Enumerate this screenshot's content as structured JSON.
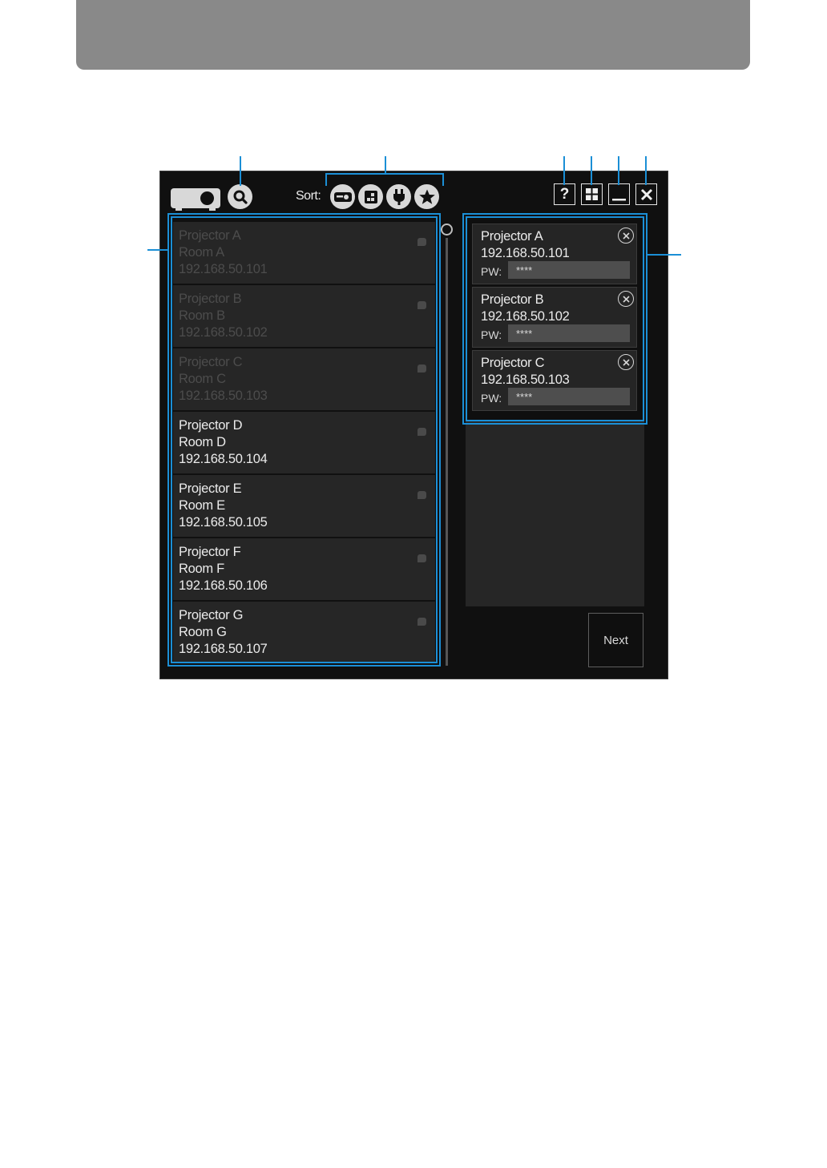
{
  "window": {
    "sort_label": "Sort:",
    "next_label": "Next",
    "icons": {
      "logo": "projector-logo-icon",
      "search": "search-icon",
      "sort_buttons": [
        "sort-by-projector-name-icon",
        "sort-by-room-icon",
        "sort-by-connection-icon",
        "sort-by-favorite-icon"
      ],
      "title_bar": [
        "help-icon",
        "grid-view-icon",
        "minimize-icon",
        "close-icon"
      ]
    }
  },
  "projector_list": [
    {
      "name": "Projector A",
      "room": "Room A",
      "ip": "192.168.50.101",
      "state": "dim"
    },
    {
      "name": "Projector B",
      "room": "Room B",
      "ip": "192.168.50.102",
      "state": "dim"
    },
    {
      "name": "Projector C",
      "room": "Room C",
      "ip": "192.168.50.103",
      "state": "dim"
    },
    {
      "name": "Projector D",
      "room": "Room D",
      "ip": "192.168.50.104",
      "state": "available"
    },
    {
      "name": "Projector E",
      "room": "Room E",
      "ip": "192.168.50.105",
      "state": "available"
    },
    {
      "name": "Projector F",
      "room": "Room F",
      "ip": "192.168.50.106",
      "state": "available"
    },
    {
      "name": "Projector G",
      "room": "Room G",
      "ip": "192.168.50.107",
      "state": "available"
    }
  ],
  "selected_projectors": [
    {
      "name": "Projector A",
      "ip": "192.168.50.101",
      "pw_label": "PW:",
      "pw_value": "****"
    },
    {
      "name": "Projector B",
      "ip": "192.168.50.102",
      "pw_label": "PW:",
      "pw_value": "****"
    },
    {
      "name": "Projector C",
      "ip": "192.168.50.103",
      "pw_label": "PW:",
      "pw_value": "****"
    }
  ],
  "colors": {
    "callout": "#1b8fd6",
    "window_bg": "#101010",
    "item_bg": "#262626",
    "text_active": "#ebebeb",
    "text_dim": "#4c4c4c",
    "banner": "#898989"
  }
}
